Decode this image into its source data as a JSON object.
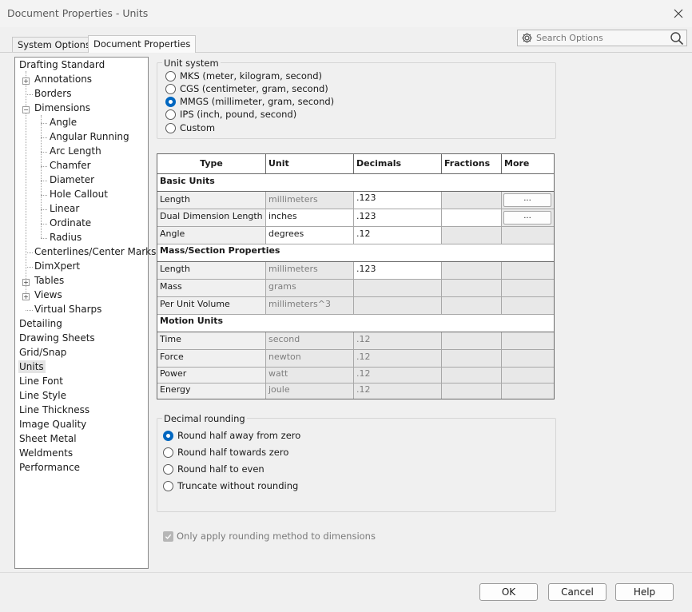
{
  "window": {
    "title": "Document Properties - Units"
  },
  "tabs": [
    {
      "label": "System Options"
    },
    {
      "label": "Document Properties"
    }
  ],
  "search": {
    "placeholder": "Search Options"
  },
  "tree": [
    {
      "label": "Drafting Standard"
    },
    {
      "label": "Annotations"
    },
    {
      "label": "Borders"
    },
    {
      "label": "Dimensions"
    },
    {
      "label": "Angle"
    },
    {
      "label": "Angular Running"
    },
    {
      "label": "Arc Length"
    },
    {
      "label": "Chamfer"
    },
    {
      "label": "Diameter"
    },
    {
      "label": "Hole Callout"
    },
    {
      "label": "Linear"
    },
    {
      "label": "Ordinate"
    },
    {
      "label": "Radius"
    },
    {
      "label": "Centerlines/Center Marks"
    },
    {
      "label": "DimXpert"
    },
    {
      "label": "Tables"
    },
    {
      "label": "Views"
    },
    {
      "label": "Virtual Sharps"
    },
    {
      "label": "Detailing"
    },
    {
      "label": "Drawing Sheets"
    },
    {
      "label": "Grid/Snap"
    },
    {
      "label": "Units"
    },
    {
      "label": "Line Font"
    },
    {
      "label": "Line Style"
    },
    {
      "label": "Line Thickness"
    },
    {
      "label": "Image Quality"
    },
    {
      "label": "Sheet Metal"
    },
    {
      "label": "Weldments"
    },
    {
      "label": "Performance"
    }
  ],
  "unit_system": {
    "label": "Unit system",
    "selected": "MMGS (millimeter, gram, second)",
    "options": [
      {
        "label": "MKS  (meter, kilogram, second)"
      },
      {
        "label": "CGS  (centimeter, gram, second)"
      },
      {
        "label": "MMGS (millimeter, gram, second)"
      },
      {
        "label": "IPS  (inch, pound, second)"
      },
      {
        "label": "Custom"
      }
    ]
  },
  "table": {
    "headers": {
      "type": "Type",
      "unit": "Unit",
      "decimals": "Decimals",
      "fractions": "Fractions",
      "more": "More"
    },
    "sections": {
      "basic": "Basic Units",
      "mass": "Mass/Section Properties",
      "motion": "Motion Units"
    },
    "rows": [
      {
        "type": "Length",
        "unit": "millimeters",
        "decimals": ".123",
        "more": "..."
      },
      {
        "type": "Dual Dimension Length",
        "unit": "inches",
        "decimals": ".123",
        "more": "..."
      },
      {
        "type": "Angle",
        "unit": "degrees",
        "decimals": ".12"
      },
      {
        "type": "Length",
        "unit": "millimeters",
        "decimals": ".123"
      },
      {
        "type": "Mass",
        "unit": "grams",
        "decimals": ""
      },
      {
        "type": "Per Unit Volume",
        "unit": "millimeters^3",
        "decimals": ""
      },
      {
        "type": "Time",
        "unit": "second",
        "decimals": ".12"
      },
      {
        "type": "Force",
        "unit": "newton",
        "decimals": ".12"
      },
      {
        "type": "Power",
        "unit": "watt",
        "decimals": ".12"
      },
      {
        "type": "Energy",
        "unit": "joule",
        "decimals": ".12"
      }
    ]
  },
  "rounding": {
    "label": "Decimal rounding",
    "selected": "Round half away from zero",
    "options": [
      {
        "label": "Round half away from zero"
      },
      {
        "label": "Round half towards zero"
      },
      {
        "label": "Round half to even"
      },
      {
        "label": "Truncate without rounding"
      }
    ]
  },
  "only_apply": {
    "label": "Only apply rounding method to dimensions",
    "checked": true,
    "enabled": false
  },
  "buttons": {
    "ok": "OK",
    "cancel": "Cancel",
    "help": "Help"
  },
  "colors": {
    "accent": "#0067c0",
    "selection": "#e4e4e4"
  }
}
